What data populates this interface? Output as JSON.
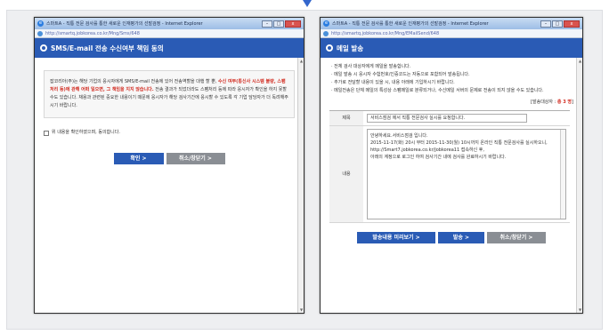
{
  "left_window": {
    "title": "스마트A - 직통 전문 검사를 통한 새로운 인재평가의 선발검정 - Internet Explorer",
    "url": "http://smartq.jobkorea.co.kr/Mng/Sms/648",
    "header": "SMS/E-mail 전송 수신여부 책임 동의",
    "notice_part1": "잡코리아(주)는 해당 기업의 응시자에게 SMS/E-mail 전송에 있어 전송역할을 대행 할 뿐, ",
    "notice_red": "수신 여부(통신사 시스템 불량, 스팸처리 등)에 관해 어떠 일으면, 그 책임을 지지 않습니다.",
    "notice_part2": " 전송 결과가 되었더라도 스팸처리 등에 따라 응시자가 확인을 하지 못할 수도 있습니다. 채용과 관련된 중요한 내용이기 때문에 응시자가 해당 검사기간에 응시할 수 있도록 각 기업 담당자가 더 독려해주시기 바랍니다.",
    "checkbox_label": "위 내용을 확인하였으며, 동의합니다.",
    "confirm_button": "확인  >",
    "cancel_button": "취소/창닫기 >"
  },
  "right_window": {
    "title": "스마트A - 직통 전문 검사를 통한 새로운 인재평가의 선발검정 - Internet Explorer",
    "url": "http://smartq.jobkorea.co.kr/Mng/EMailSend/648",
    "header": "메일 발송",
    "instructions": [
      "· 전체 검사 대상자에게 메일을 발송합니다.",
      "· 메일 발송 시 응시자 수험번호/인증코드는 자동으로 포함되어 발송됩니다.",
      "· 추가로 전달할 내용이 있을 시, 내용 아래에 기입하시기 바랍니다.",
      "· 메일전송은 단체 메일의 특성상 스팸메일로 분류되거나, 수신메일 서버의 문제로 전송이 되지 않을 수도 있습니다."
    ],
    "count_label": "[발송대상자 : ",
    "count_value": "총 3 명",
    "count_suffix": "]",
    "subject_label": "제목",
    "subject_value": "서비스점검 에서 직통 전문검사 실시를 요청합니다.",
    "body_label": "내용",
    "body_lines": [
      "안녕하세요.서비스점검 입니다.",
      "2015-11-17(화) 20시 부터 2015-11-30(월) 10시까지 온라인 직통 전문검사를 실시하오니,",
      "http://Smart7.jobkorea.co.kr/Jobkorea11 접속하신 후,",
      "아래의 계정으로 로그인 하여 검사기간 내에 검사를 완료하시기 바랍니다."
    ],
    "preview_button": "발송내용 미리보기 >",
    "send_button": "발송  >",
    "cancel_button": "취소/창닫기 >"
  },
  "window_buttons": {
    "minimize": "–",
    "maximize": "□",
    "close": "x"
  },
  "colors": {
    "accent": "#2a5bb5",
    "warning": "#d12a1f",
    "gray_button": "#8a8e94"
  }
}
